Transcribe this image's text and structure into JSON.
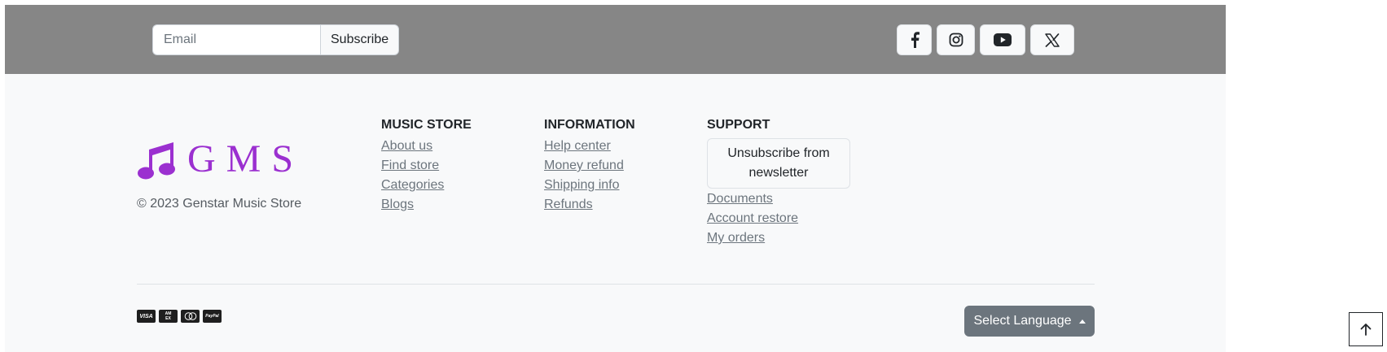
{
  "newsletter": {
    "email_placeholder": "Email",
    "subscribe_label": "Subscribe"
  },
  "social": [
    "facebook-icon",
    "instagram-icon",
    "youtube-icon",
    "x-icon"
  ],
  "brand": {
    "name": "GMS",
    "logo_icon": "music-note-icon",
    "color": "#9b30d0"
  },
  "copyright": "© 2023 Genstar Music Store",
  "columns": {
    "music_store": {
      "title": "MUSIC STORE",
      "links": [
        "About us",
        "Find store",
        "Categories",
        "Blogs"
      ]
    },
    "information": {
      "title": "INFORMATION",
      "links": [
        "Help center",
        "Money refund",
        "Shipping info",
        "Refunds"
      ]
    },
    "support": {
      "title": "SUPPORT",
      "unsubscribe_label": "Unsubscribe from newsletter",
      "links": [
        "Documents",
        "Account restore",
        "My orders"
      ]
    }
  },
  "payments": [
    {
      "icon": "visa-icon",
      "label": "VISA"
    },
    {
      "icon": "amex-icon",
      "label": "AM EX"
    },
    {
      "icon": "mastercard-icon",
      "label": ""
    },
    {
      "icon": "paypal-icon",
      "label": "PayPal"
    }
  ],
  "language_button": "Select Language",
  "back_to_top_icon": "arrow-up-icon",
  "colors": {
    "topbar": "#868686",
    "footer_bg": "#f8f9fa",
    "secondary_btn": "#6c757d"
  }
}
